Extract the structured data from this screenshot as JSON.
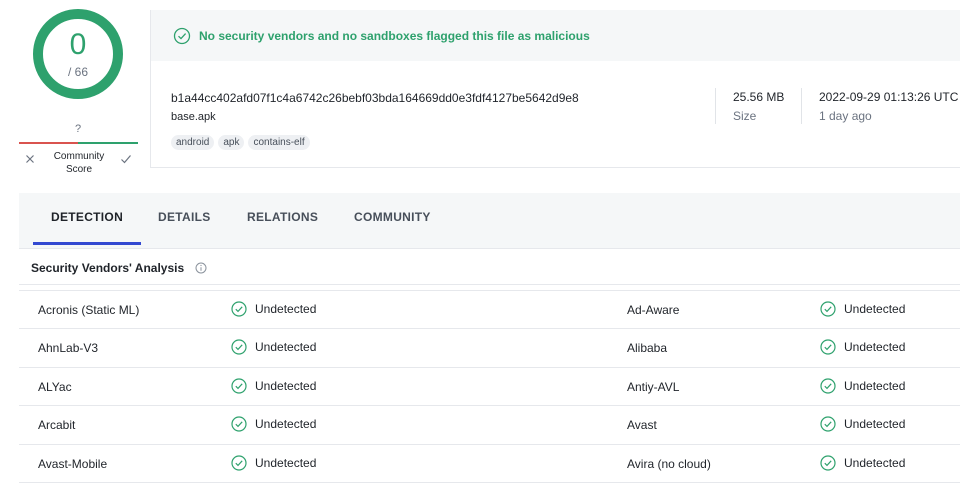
{
  "score": {
    "detections": "0",
    "total": "/ 66",
    "fraction": 0,
    "color": "#2ea16d"
  },
  "community": {
    "score_value": "?",
    "label_line1": "Community",
    "label_line2": "Score"
  },
  "summary": {
    "banner": "No security vendors and no sandboxes flagged this file as malicious",
    "hash": "b1a44cc402afd07f1c4a6742c26bebf03bda164669dd0e3fdf4127be5642d9e8",
    "filename": "base.apk",
    "tags": [
      "android",
      "apk",
      "contains-elf"
    ],
    "size_value": "25.56 MB",
    "size_label": "Size",
    "date_value": "2022-09-29 01:13:26 UTC",
    "date_label": "1 day ago"
  },
  "tabs": [
    {
      "label": "DETECTION",
      "active": true
    },
    {
      "label": "DETAILS",
      "active": false
    },
    {
      "label": "RELATIONS",
      "active": false
    },
    {
      "label": "COMMUNITY",
      "active": false
    }
  ],
  "section": {
    "title": "Security Vendors' Analysis"
  },
  "vendors": [
    {
      "left": {
        "name": "Acronis (Static ML)",
        "result": "Undetected"
      },
      "right": {
        "name": "Ad-Aware",
        "result": "Undetected"
      }
    },
    {
      "left": {
        "name": "AhnLab-V3",
        "result": "Undetected"
      },
      "right": {
        "name": "Alibaba",
        "result": "Undetected"
      }
    },
    {
      "left": {
        "name": "ALYac",
        "result": "Undetected"
      },
      "right": {
        "name": "Antiy-AVL",
        "result": "Undetected"
      }
    },
    {
      "left": {
        "name": "Arcabit",
        "result": "Undetected"
      },
      "right": {
        "name": "Avast",
        "result": "Undetected"
      }
    },
    {
      "left": {
        "name": "Avast-Mobile",
        "result": "Undetected"
      },
      "right": {
        "name": "Avira (no cloud)",
        "result": "Undetected"
      }
    }
  ],
  "colors": {
    "clean": "#2ea16d",
    "accent": "#3349d1",
    "flagged": "#d9534f"
  },
  "icons": {
    "banner": "check-circle-icon",
    "status": "check-circle-icon",
    "info": "info-icon",
    "vote_down": "close-icon",
    "vote_up": "check-icon"
  }
}
